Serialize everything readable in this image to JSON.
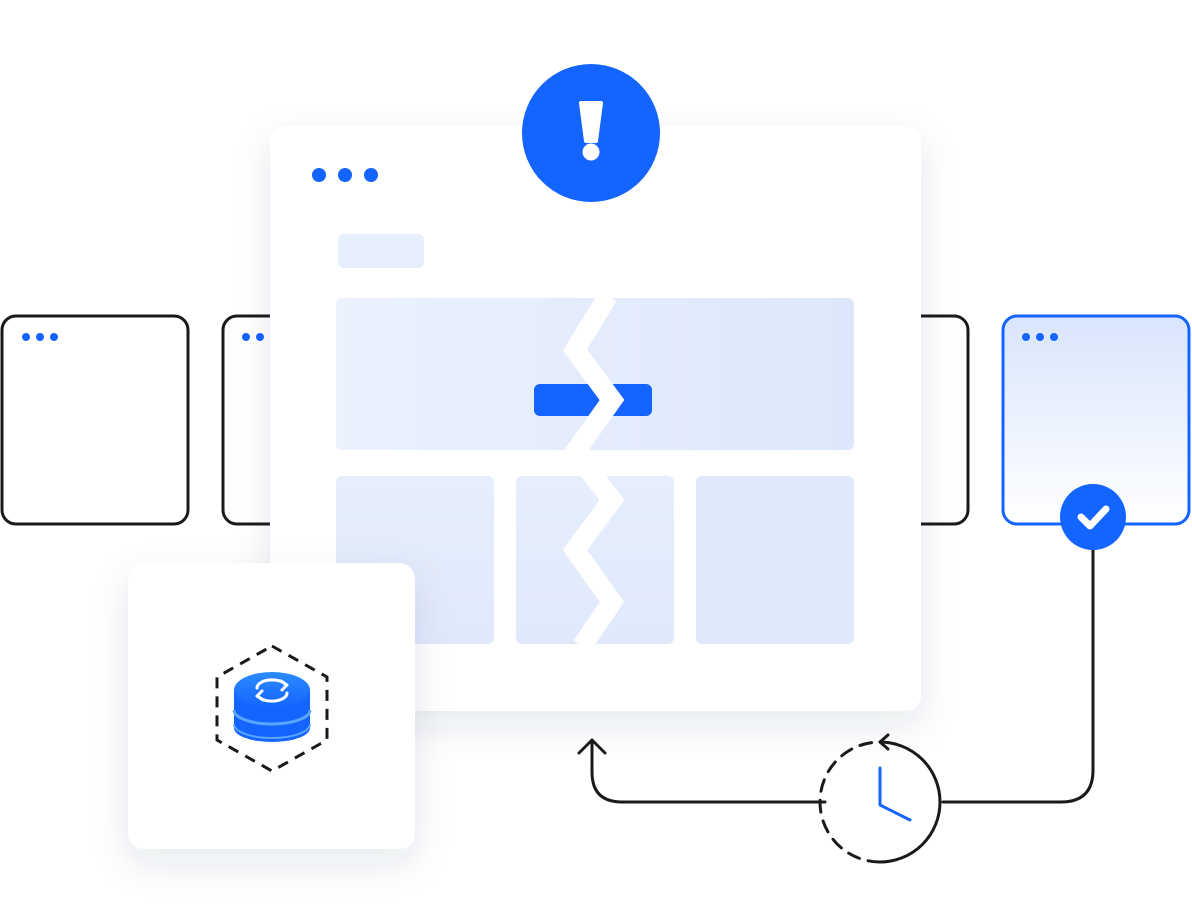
{
  "colors": {
    "accent": "#1464FF",
    "line": "#1A1A1A",
    "panel_fill": "#E4ECFC",
    "card_bg": "#FFFFFF"
  },
  "icons": {
    "alert": "exclamation-icon",
    "success": "checkmark-icon",
    "schedule": "clock-refresh-icon",
    "database": "database-sync-icon"
  }
}
